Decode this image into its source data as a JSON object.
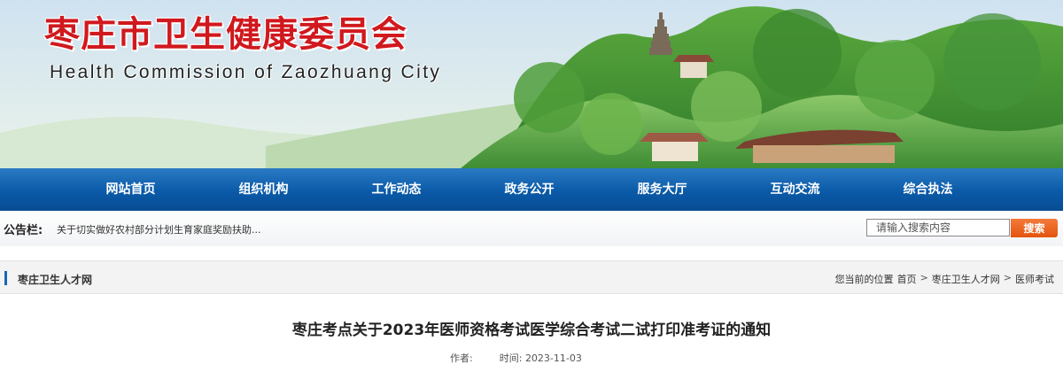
{
  "header": {
    "title": "枣庄市卫生健康委员会",
    "subtitle": "Health Commission of Zaozhuang City"
  },
  "nav": {
    "items": [
      "网站首页",
      "组织机构",
      "工作动态",
      "政务公开",
      "服务大厅",
      "互动交流",
      "综合执法"
    ]
  },
  "notice": {
    "label": "公告栏:",
    "text": "关于切实做好农村部分计划生育家庭奖励扶助..."
  },
  "search": {
    "placeholder": "请输入搜索内容",
    "button_label": "搜索"
  },
  "section": {
    "title": "枣庄卫生人才网"
  },
  "breadcrumb": {
    "prefix": "您当前的位置",
    "items": [
      "首页",
      "枣庄卫生人才网",
      "医师考试"
    ],
    "separator": ">"
  },
  "article": {
    "title": "枣庄考点关于2023年医师资格考试医学综合考试二试打印准考证的通知",
    "author_label": "作者:",
    "author": "",
    "time_label": "时间:",
    "time": "2023-11-03"
  },
  "colors": {
    "title_red": "#d0191e",
    "nav_blue": "#0a5aa8",
    "search_orange": "#e4540e",
    "accent_blue": "#1768b8"
  }
}
